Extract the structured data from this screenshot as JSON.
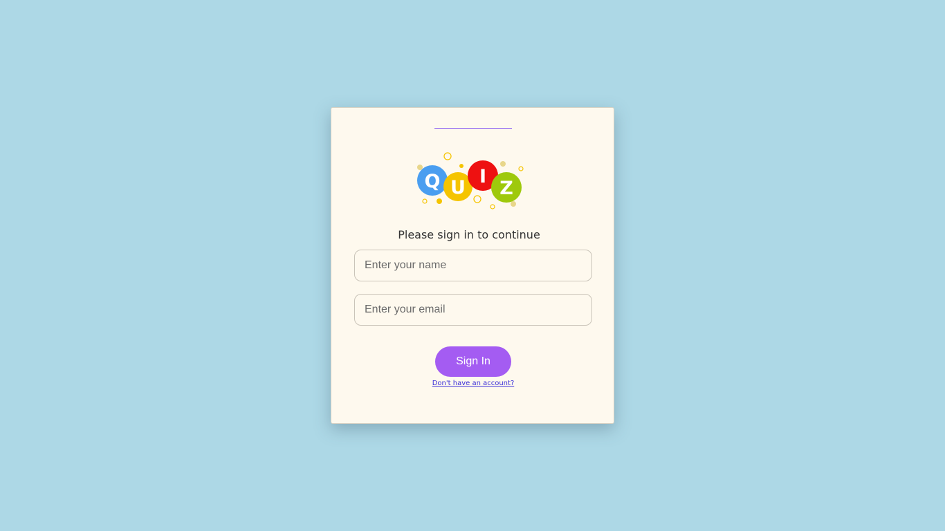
{
  "logo": {
    "letters": [
      "Q",
      "U",
      "I",
      "Z"
    ],
    "colors": [
      "#4a9ef0",
      "#f5c400",
      "#ee1111",
      "#9ec90c"
    ]
  },
  "form": {
    "subtitle": "Please sign in to continue",
    "name_placeholder": "Enter your name",
    "email_placeholder": "Enter your email",
    "submit_label": "Sign In",
    "signup_link": "Don't have an account?"
  },
  "colors": {
    "background": "#add8e6",
    "card": "#fef9ee",
    "accent": "#a45cf2",
    "link": "#3b2fd8"
  }
}
